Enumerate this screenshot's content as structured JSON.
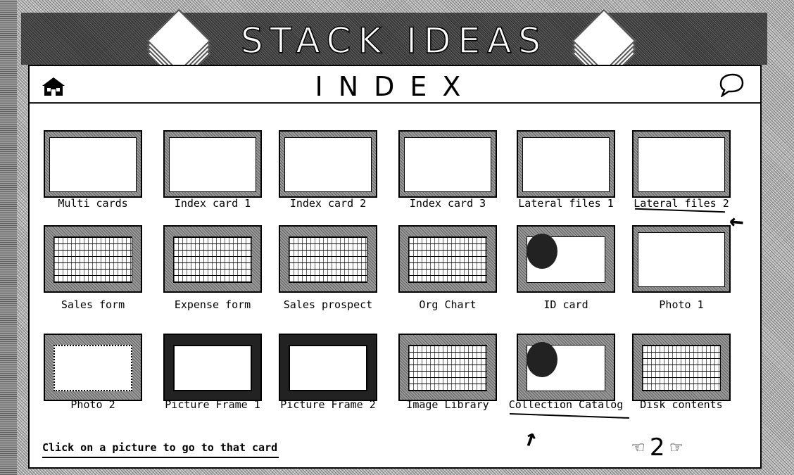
{
  "header": {
    "title": "STACK IDEAS",
    "subtitle": "INDEX"
  },
  "cards": [
    {
      "label": "Multi cards",
      "style": "plain"
    },
    {
      "label": "Index card 1",
      "style": "plain"
    },
    {
      "label": "Index card 2",
      "style": "plain"
    },
    {
      "label": "Index card 3",
      "style": "plain"
    },
    {
      "label": "Lateral files 1",
      "style": "plain"
    },
    {
      "label": "Lateral files 2",
      "style": "plain"
    },
    {
      "label": "Sales form",
      "style": "form"
    },
    {
      "label": "Expense form",
      "style": "form"
    },
    {
      "label": "Sales prospect",
      "style": "form"
    },
    {
      "label": "Org Chart",
      "style": "form"
    },
    {
      "label": "ID card",
      "style": "photo"
    },
    {
      "label": "Photo 1",
      "style": "plain"
    },
    {
      "label": "Photo 2",
      "style": "dotted"
    },
    {
      "label": "Picture Frame 1",
      "style": "dark"
    },
    {
      "label": "Picture Frame 2",
      "style": "dark"
    },
    {
      "label": "Image Library",
      "style": "form"
    },
    {
      "label": "Collection Catalog",
      "style": "photo"
    },
    {
      "label": "Disk contents",
      "style": "form"
    }
  ],
  "footer": {
    "message": "Click on a picture to go to that card",
    "page": "2"
  },
  "icons": {
    "home": "home-icon",
    "balloon": "speech-balloon-icon",
    "prev": "hand-pointing-left-icon",
    "next": "hand-pointing-right-icon"
  }
}
